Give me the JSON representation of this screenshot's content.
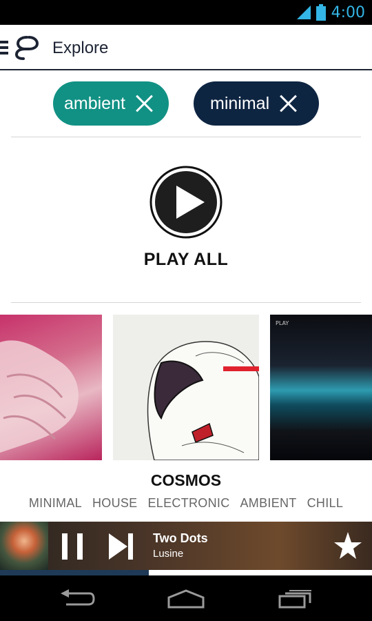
{
  "status_bar": {
    "time": "4:00"
  },
  "app_bar": {
    "title": "Explore",
    "menu_icon": "hamburger-icon",
    "logo_icon": "8tracks-logo"
  },
  "filters": [
    {
      "label": "ambient",
      "color": "#119184"
    },
    {
      "label": "minimal",
      "color": "#0e2542"
    }
  ],
  "play_all": {
    "label": "PLAY ALL"
  },
  "playlist": {
    "title": "COSMOS",
    "tags": [
      "MINIMAL",
      "HOUSE",
      "ELECTRONIC",
      "AMBIENT",
      "CHILL"
    ],
    "cover_label": "PLAY"
  },
  "now_playing": {
    "title": "Two Dots",
    "artist": "Lusine",
    "progress": 0.4
  },
  "colors": {
    "accent": "#33b5e5",
    "navy": "#0e2542",
    "teal": "#119184"
  }
}
